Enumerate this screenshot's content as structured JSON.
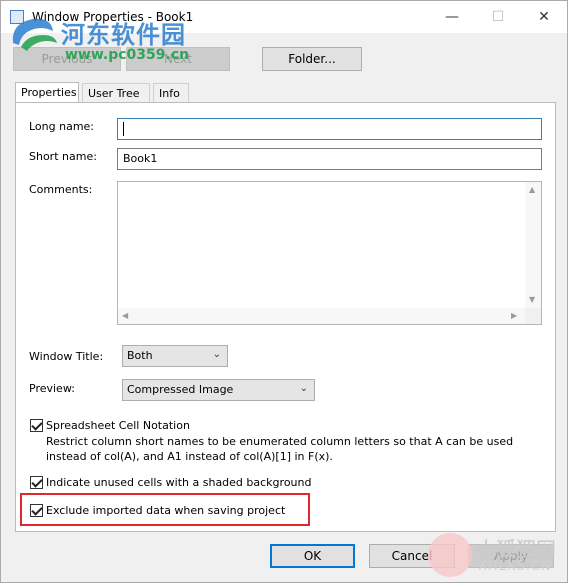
{
  "window": {
    "title": "Window Properties - Book1",
    "minimize": "—",
    "maximize": "☐",
    "close": "✕"
  },
  "toolbar": {
    "previous_label": "Previous",
    "next_label": "Next",
    "folder_label": "Folder..."
  },
  "tabs": [
    {
      "label": "Properties",
      "active": true
    },
    {
      "label": "User Tree",
      "active": false
    },
    {
      "label": "Info",
      "active": false
    }
  ],
  "form": {
    "long_name_label": "Long name:",
    "long_name_value": "",
    "short_name_label": "Short name:",
    "short_name_value": "Book1",
    "comments_label": "Comments:",
    "comments_value": "",
    "window_title_label": "Window Title:",
    "window_title_value": "Both",
    "preview_label": "Preview:",
    "preview_value": "Compressed Image"
  },
  "options": {
    "spreadsheet_notation_label": "Spreadsheet Cell Notation",
    "spreadsheet_notation_checked": true,
    "spreadsheet_notation_desc": "Restrict column short names to be enumerated column letters so that A can be used instead of col(A), and A1 instead of col(A)[1] in F(x).",
    "shaded_unused_label": "Indicate unused cells with a shaded background",
    "shaded_unused_checked": true,
    "exclude_imported_label": "Exclude imported data when saving project",
    "exclude_imported_checked": true
  },
  "footer": {
    "ok_label": "OK",
    "cancel_label": "Cancel",
    "apply_label": "Apply"
  },
  "watermarks": {
    "top_name": "河东软件园",
    "top_url": "www.pc0359.cn",
    "bottom_name": "小狐狸网",
    "bottom_url": "XHLKS.CN"
  },
  "colors": {
    "focus_border": "#3c7fb1",
    "highlight_border": "#e0282e",
    "default_button": "#0078d7"
  }
}
